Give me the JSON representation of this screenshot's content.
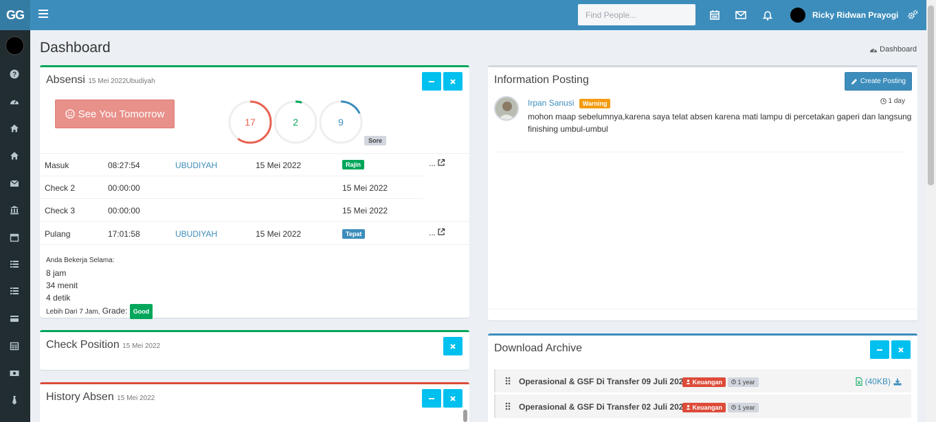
{
  "brand": {
    "logo": "GG"
  },
  "topbar": {
    "search_placeholder": "Find People...",
    "user_name": "Ricky Ridwan Prayogi",
    "icons": [
      "menu-icon",
      "calendar-icon",
      "envelope-icon",
      "bell-icon",
      "gears-icon"
    ]
  },
  "sidebar": {
    "icons": [
      "question-icon",
      "dashboard-icon",
      "home-icon",
      "home-icon",
      "envelope-icon",
      "bank-icon",
      "calendar-icon",
      "list-icon",
      "list-icon",
      "credit-card-icon",
      "calendar-grid-icon",
      "money-icon",
      "tie-icon"
    ]
  },
  "page": {
    "title": "Dashboard",
    "breadcrumb": "Dashboard"
  },
  "absensi": {
    "title": "Absensi",
    "subtitle": "15 Mei 2022Ubudiyah",
    "button": "See You Tomorrow",
    "gauges": [
      {
        "value": "17",
        "color": "#e8614f",
        "fraction": 0.6
      },
      {
        "value": "2",
        "color": "#00a65a",
        "fraction": 0.05
      },
      {
        "value": "9",
        "color": "#3c8dbc",
        "fraction": 0.18
      }
    ],
    "gauge_badge": "Sore",
    "rows": [
      {
        "label": "Masuk",
        "time": "08:27:54",
        "place": "UBUDIYAH",
        "date": "15 Mei 2022",
        "badge": "Rajin",
        "badge_color": "green",
        "more": "..."
      },
      {
        "label": "Check 2",
        "time": "00:00:00",
        "place": "",
        "date": "",
        "date2": "15 Mei 2022"
      },
      {
        "label": "Check 3",
        "time": "00:00:00",
        "place": "",
        "date": "",
        "date2": "15 Mei 2022"
      },
      {
        "label": "Pulang",
        "time": "17:01:58",
        "place": "UBUDIYAH",
        "date": "15 Mei 2022",
        "badge": "Tepat",
        "badge_color": "blue",
        "more": "..."
      }
    ],
    "work_label": "Anda Bekerja Selama:",
    "work_hours": "8 jam",
    "work_minutes": "34 menit",
    "work_seconds": "4 detik",
    "grade_prefix": "Lebih Dari 7 Jam,",
    "grade_label": "Grade:",
    "grade_value": "Good"
  },
  "check_position": {
    "title": "Check Position",
    "subtitle": "15 Mei 2022"
  },
  "history_absen": {
    "title": "History Absen",
    "subtitle": "15 Mei 2022"
  },
  "information_posting": {
    "title": "Information Posting",
    "create_button": "Create Posting",
    "post": {
      "author": "Irpan Sanusi",
      "badge": "Warning",
      "time": "1 day",
      "text": "mohon maap sebelumnya,karena saya telat absen karena mati lampu di percetakan gaperi dan langsung finishing umbul-umbul"
    }
  },
  "download_archive": {
    "title": "Download Archive",
    "items": [
      {
        "title": "Operasional & GSF Di Transfer 09 Juli 2020",
        "category": "Keuangan",
        "age": "1 year",
        "size": "(40KB)"
      },
      {
        "title": "Operasional & GSF Di Transfer 02 Juli 2020",
        "category": "Keuangan",
        "age": "1 year"
      }
    ]
  }
}
